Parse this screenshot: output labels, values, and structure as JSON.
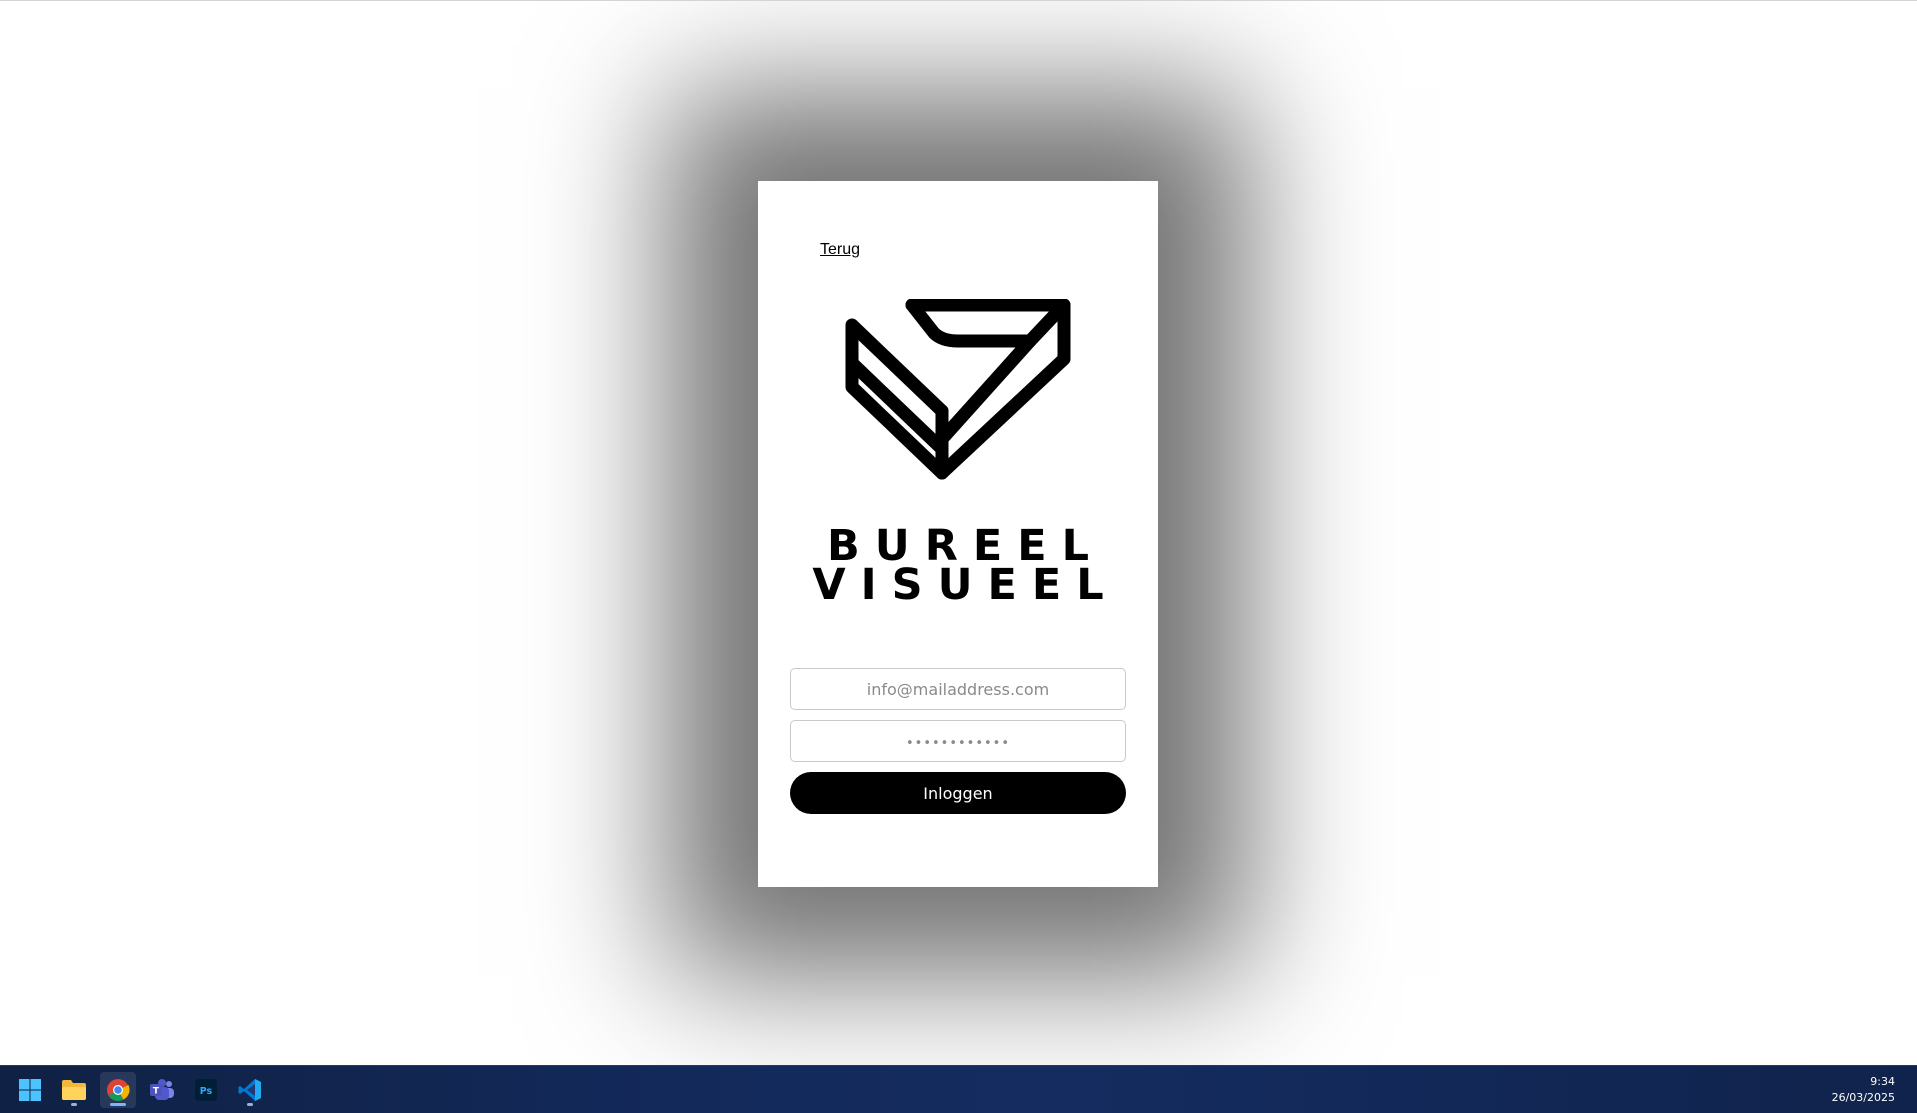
{
  "login": {
    "back_link": "Terug",
    "brand_line1": "BUREEL",
    "brand_line2": "VISUEEL",
    "email_placeholder": "info@mailaddress.com",
    "password_placeholder": "••••••••••••",
    "submit_label": "Inloggen"
  },
  "taskbar": {
    "apps": [
      {
        "name": "start-menu",
        "icon": "windows-icon"
      },
      {
        "name": "file-explorer",
        "icon": "folder-icon",
        "running": true
      },
      {
        "name": "chrome",
        "icon": "chrome-icon",
        "running": true,
        "active": true
      },
      {
        "name": "teams",
        "icon": "teams-icon"
      },
      {
        "name": "photoshop",
        "icon": "photoshop-icon",
        "label": "Ps"
      },
      {
        "name": "vscode",
        "icon": "vscode-icon",
        "running": true
      }
    ],
    "time": "9:34",
    "date": "26/03/2025"
  },
  "colors": {
    "brand": "#000000",
    "button_text": "#ffffff",
    "taskbar": "#13295a"
  }
}
